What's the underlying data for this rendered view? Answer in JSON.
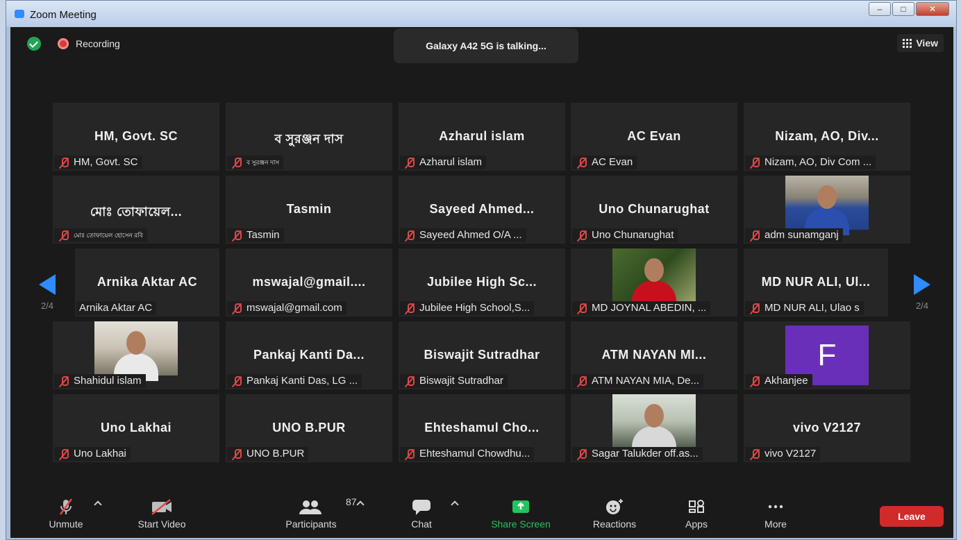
{
  "window": {
    "title": "Zoom Meeting",
    "minimize": "–",
    "maximize": "□",
    "close": "✕"
  },
  "topbar": {
    "recording_label": "Recording",
    "talking_text": "Galaxy A42 5G is talking...",
    "view_label": "View"
  },
  "tiles": [
    {
      "big": "HM, Govt. SC",
      "label": "HM, Govt. SC"
    },
    {
      "big": "ব সুরঞ্জন দাস",
      "label": "ব সুরঞ্জন দাস"
    },
    {
      "big": "Azharul islam",
      "label": "Azharul islam"
    },
    {
      "big": "AC Evan",
      "label": "AC Evan"
    },
    {
      "big": "Nizam, AO, Div...",
      "label": "Nizam, AO, Div Com ..."
    },
    {
      "big": "মোঃ তোফায়েল...",
      "label": "মোঃ তোফায়েল হোসেন রবি"
    },
    {
      "big": "Tasmin",
      "label": "Tasmin"
    },
    {
      "big": "Sayeed Ahmed...",
      "label": "Sayeed Ahmed O/A ..."
    },
    {
      "big": "Uno Chunarughat",
      "label": "Uno Chunarughat"
    },
    {
      "big": "",
      "label": "adm sunamganj"
    },
    {
      "big": "Arnika Aktar AC",
      "label": "Arnika Aktar AC"
    },
    {
      "big": "mswajal@gmail....",
      "label": "mswajal@gmail.com"
    },
    {
      "big": "Jubilee High Sc...",
      "label": "Jubilee High School,S..."
    },
    {
      "big": "",
      "label": "MD JOYNAL ABEDIN, ..."
    },
    {
      "big": "MD NUR ALI, Ul...",
      "label": "MD NUR ALI, Ulao s"
    },
    {
      "big": "",
      "label": "Shahidul islam"
    },
    {
      "big": "Pankaj Kanti Da...",
      "label": "Pankaj Kanti Das, LG ..."
    },
    {
      "big": "Biswajit Sutradhar",
      "label": "Biswajit Sutradhar"
    },
    {
      "big": "ATM NAYAN MI...",
      "label": "ATM NAYAN MIA, De..."
    },
    {
      "big": "",
      "label": "Akhanjee",
      "avatar": "F"
    },
    {
      "big": "Uno Lakhai",
      "label": "Uno Lakhai"
    },
    {
      "big": "UNO B.PUR",
      "label": "UNO B.PUR"
    },
    {
      "big": "Ehteshamul Cho...",
      "label": "Ehteshamul Chowdhu..."
    },
    {
      "big": "",
      "label": "Sagar Talukder off.as..."
    },
    {
      "big": "vivo V2127",
      "label": "vivo V2127"
    }
  ],
  "pagination": {
    "left": "2/4",
    "right": "2/4"
  },
  "toolbar": {
    "unmute": "Unmute",
    "start_video": "Start Video",
    "participants": "Participants",
    "participants_count": "87",
    "chat": "Chat",
    "share_screen": "Share Screen",
    "reactions": "Reactions",
    "apps": "Apps",
    "more": "More",
    "leave": "Leave"
  },
  "colors": {
    "accent": "#2d8cff",
    "share": "#23c45e",
    "leave": "#d02b2b",
    "mute": "#e04848"
  }
}
